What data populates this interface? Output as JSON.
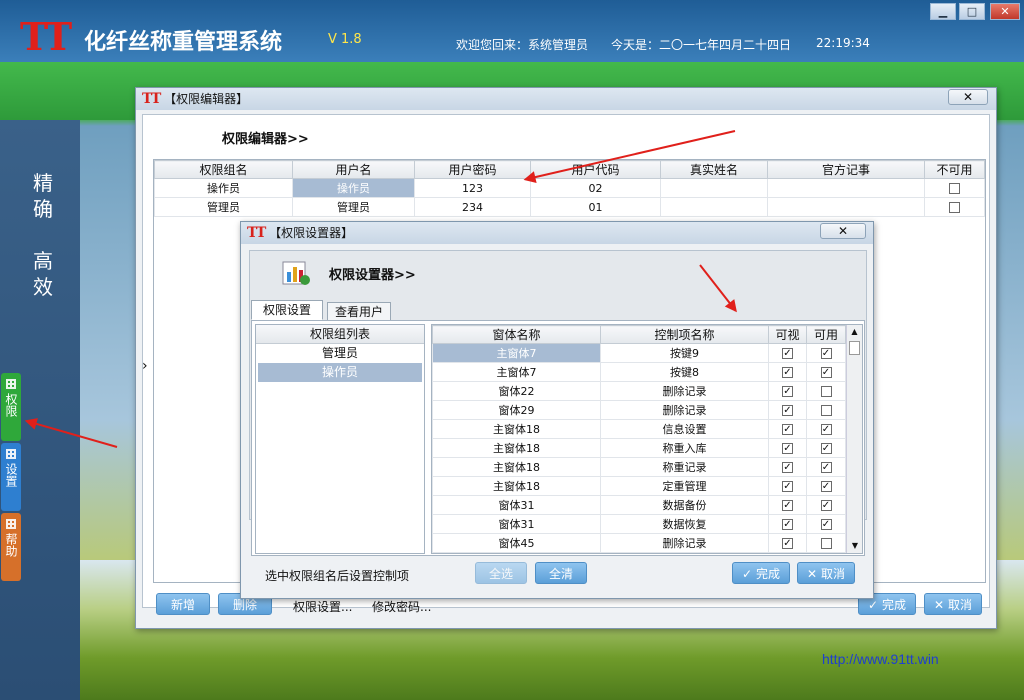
{
  "app": {
    "logo": "TT",
    "title": "化纤丝称重管理系统",
    "version": "V 1.8",
    "welcome": "欢迎您回来：系统管理员",
    "date": "今天是：二〇一七年四月二十四日",
    "time": "22:19:34",
    "min": "▁",
    "max": "□",
    "close": "✕"
  },
  "slogan": {
    "line1a": "精",
    "line1b": "确",
    "line2a": "高",
    "line2b": "效"
  },
  "side_tabs": [
    {
      "label": "权限",
      "color": "#2fa83a"
    },
    {
      "label": "设置",
      "color": "#2e7fd0"
    },
    {
      "label": "帮助",
      "color": "#d6702a"
    }
  ],
  "url": "http://www.91tt.win",
  "editor": {
    "title": "【权限编辑器】",
    "heading": "权限编辑器>>",
    "close": "✕",
    "columns": [
      "权限组名",
      "用户名",
      "用户密码",
      "用户代码",
      "真实姓名",
      "官方记事",
      "不可用"
    ],
    "rows": [
      {
        "group": "操作员",
        "user": "操作员",
        "pwd": "123",
        "code": "02",
        "name": "",
        "note": "",
        "disabled": false
      },
      {
        "group": "管理员",
        "user": "管理员",
        "pwd": "234",
        "code": "01",
        "name": "",
        "note": "",
        "disabled": false
      }
    ],
    "expander": "›",
    "btn_add": "新增",
    "btn_del": "删除",
    "link_perm": "权限设置...",
    "link_pwd": "修改密码...",
    "btn_ok": "完成",
    "btn_cancel": "取消"
  },
  "setter": {
    "title": "【权限设置器】",
    "heading": "权限设置器>>",
    "close": "✕",
    "tab1": "权限设置",
    "tab2": "查看用户",
    "group_header": "权限组列表",
    "groups": [
      "管理员",
      "操作员"
    ],
    "columns": [
      "窗体名称",
      "控制项名称",
      "可视",
      "可用"
    ],
    "rows": [
      {
        "form": "主窗体7",
        "ctrl": "按键9",
        "visible": true,
        "enabled": true
      },
      {
        "form": "主窗体7",
        "ctrl": "按键8",
        "visible": true,
        "enabled": true
      },
      {
        "form": "窗体22",
        "ctrl": "删除记录",
        "visible": true,
        "enabled": false
      },
      {
        "form": "窗体29",
        "ctrl": "删除记录",
        "visible": true,
        "enabled": false
      },
      {
        "form": "主窗体18",
        "ctrl": "信息设置",
        "visible": true,
        "enabled": true
      },
      {
        "form": "主窗体18",
        "ctrl": "称重入库",
        "visible": true,
        "enabled": true
      },
      {
        "form": "主窗体18",
        "ctrl": "称重记录",
        "visible": true,
        "enabled": true
      },
      {
        "form": "主窗体18",
        "ctrl": "定重管理",
        "visible": true,
        "enabled": true
      },
      {
        "form": "窗体31",
        "ctrl": "数据备份",
        "visible": true,
        "enabled": true
      },
      {
        "form": "窗体31",
        "ctrl": "数据恢复",
        "visible": true,
        "enabled": true
      },
      {
        "form": "窗体45",
        "ctrl": "删除记录",
        "visible": true,
        "enabled": false
      }
    ],
    "hint": "选中权限组名后设置控制项",
    "btn_all": "全选",
    "btn_clear": "全清",
    "btn_ok": "完成",
    "btn_cancel": "取消",
    "scroll_up": "▲",
    "scroll_down": "▼"
  },
  "check": "✓"
}
